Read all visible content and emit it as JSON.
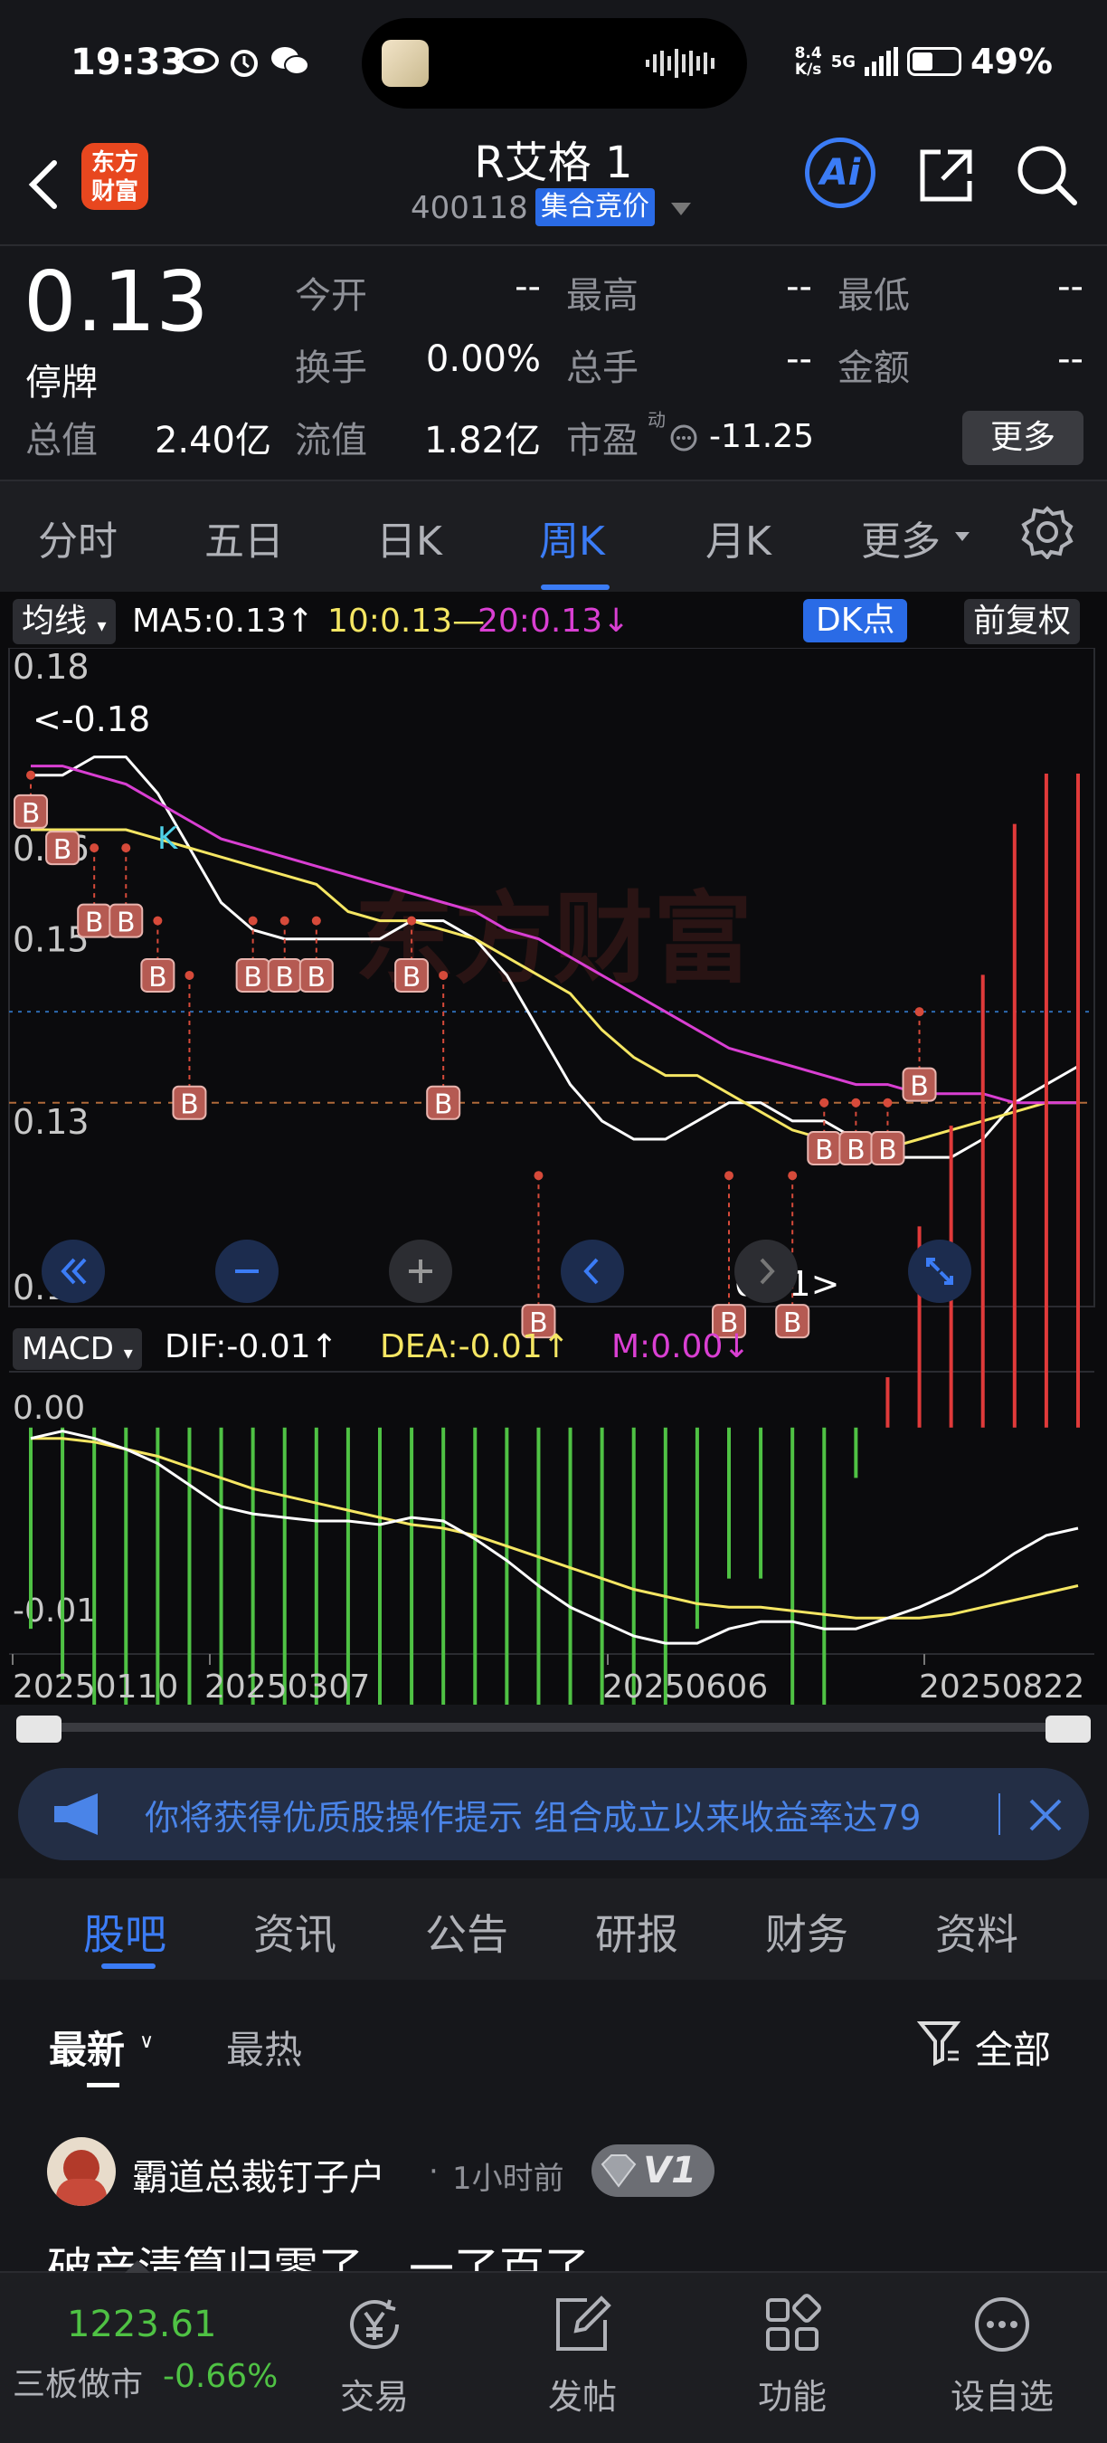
{
  "status_bar": {
    "time": "19:33",
    "net_speed_top": "8.4",
    "net_speed_bottom": "K/s",
    "network": "5G",
    "battery": "49%"
  },
  "header": {
    "logo_line1": "东方",
    "logo_line2": "财富",
    "title": "R艾格 1",
    "code": "400118",
    "auction_badge": "集合竞价",
    "ai_label": "Ai"
  },
  "quote": {
    "price": "0.13",
    "status": "停牌",
    "open_label": "今开",
    "open": "--",
    "high_label": "最高",
    "high": "--",
    "low_label": "最低",
    "low": "--",
    "turnover_label": "换手",
    "turnover": "0.00%",
    "volume_label": "总手",
    "volume": "--",
    "amount_label": "金额",
    "amount": "--",
    "mktcap_label": "总值",
    "mktcap": "2.40亿",
    "float_label": "流值",
    "float": "1.82亿",
    "pe_label": "市盈",
    "pe_sup": "动",
    "pe": "-11.25",
    "more": "更多"
  },
  "tabs": [
    "分时",
    "五日",
    "日K",
    "周K",
    "月K",
    "更多"
  ],
  "active_tab": "周K",
  "chart_toolbar": {
    "ma_selector": "均线",
    "ma5": "MA5:0.13↑",
    "ma10": "10:0.13—",
    "ma20": "20:0.13↓",
    "dk": "DK点",
    "adjust": "前复权"
  },
  "macd_toolbar": {
    "selector": "MACD",
    "dif": "DIF:-0.01↑",
    "dea": "DEA:-0.01↑",
    "m": "M:0.00↓"
  },
  "watermark": "东方财富",
  "chart_data": {
    "type": "line",
    "y_ticks": [
      "0.18",
      "0.16",
      "0.15",
      "0.13",
      "0.11"
    ],
    "annotations": [
      "<-0.18",
      "0.11>",
      "K"
    ],
    "buy_marker": "B",
    "x_ticks": [
      "20250110",
      "20250307",
      "20250606",
      "20250822"
    ],
    "macd_ticks": [
      "0.00",
      "-0.01"
    ],
    "colors": {
      "ma5": "#ffffff",
      "ma10": "#f5e663",
      "ma20": "#d93fd2",
      "macd_up": "#e03a3a",
      "macd_down": "#4fc244",
      "dea": "#f5e663",
      "dif": "#ffffff"
    },
    "series": [
      {
        "name": "MA5",
        "values": [
          0.168,
          0.168,
          0.17,
          0.17,
          0.166,
          0.16,
          0.154,
          0.151,
          0.15,
          0.15,
          0.15,
          0.15,
          0.152,
          0.152,
          0.15,
          0.146,
          0.14,
          0.134,
          0.13,
          0.128,
          0.128,
          0.13,
          0.132,
          0.132,
          0.13,
          0.13,
          0.128,
          0.126,
          0.126,
          0.126,
          0.128,
          0.132,
          0.134,
          0.136
        ]
      },
      {
        "name": "10",
        "values": [
          0.162,
          0.162,
          0.162,
          0.162,
          0.161,
          0.16,
          0.159,
          0.158,
          0.157,
          0.156,
          0.153,
          0.152,
          0.152,
          0.151,
          0.15,
          0.148,
          0.146,
          0.144,
          0.14,
          0.137,
          0.135,
          0.135,
          0.133,
          0.131,
          0.129,
          0.128,
          0.127,
          0.127,
          0.128,
          0.129,
          0.13,
          0.131,
          0.132,
          0.132
        ]
      },
      {
        "name": "20",
        "values": [
          0.169,
          0.169,
          0.168,
          0.167,
          0.165,
          0.163,
          0.161,
          0.16,
          0.159,
          0.158,
          0.157,
          0.156,
          0.155,
          0.154,
          0.153,
          0.151,
          0.15,
          0.148,
          0.146,
          0.144,
          0.142,
          0.14,
          0.138,
          0.137,
          0.136,
          0.135,
          0.134,
          0.134,
          0.133,
          0.133,
          0.133,
          0.132,
          0.132,
          0.132
        ]
      }
    ],
    "macd_bars": [
      -0.0008,
      -0.001,
      -0.0012,
      -0.0015,
      -0.0022,
      -0.003,
      -0.0034,
      -0.0032,
      -0.003,
      -0.0028,
      -0.0026,
      -0.0024,
      -0.002,
      -0.0018,
      -0.0022,
      -0.0028,
      -0.0034,
      -0.0038,
      -0.0036,
      -0.003,
      -0.0024,
      -0.0008,
      -0.0006,
      -0.0006,
      -0.0014,
      -0.0012,
      -0.0002,
      0.0002,
      0.0008,
      0.0012,
      0.0018,
      0.0024,
      0.0026,
      0.0026
    ],
    "dif": [
      -0.0003,
      -0.0001,
      -0.0003,
      -0.0006,
      -0.001,
      -0.0016,
      -0.0022,
      -0.0024,
      -0.0025,
      -0.0026,
      -0.0026,
      -0.0027,
      -0.0025,
      -0.0026,
      -0.0031,
      -0.0037,
      -0.0044,
      -0.005,
      -0.0054,
      -0.0058,
      -0.006,
      -0.006,
      -0.0056,
      -0.0054,
      -0.0054,
      -0.0056,
      -0.0056,
      -0.0053,
      -0.005,
      -0.0046,
      -0.0041,
      -0.0035,
      -0.003,
      -0.0028
    ],
    "dea": [
      -0.0003,
      -0.0003,
      -0.0004,
      -0.0006,
      -0.0008,
      -0.0011,
      -0.0014,
      -0.0017,
      -0.0019,
      -0.0021,
      -0.0023,
      -0.0025,
      -0.0027,
      -0.0028,
      -0.003,
      -0.0033,
      -0.0036,
      -0.0039,
      -0.0042,
      -0.0045,
      -0.0047,
      -0.0049,
      -0.005,
      -0.005,
      -0.0051,
      -0.0052,
      -0.0053,
      -0.0053,
      -0.0053,
      -0.0052,
      -0.005,
      -0.0048,
      -0.0046,
      -0.0044
    ]
  },
  "banner": {
    "text": "你将获得优质股操作提示 组合成立以来收益率达79"
  },
  "section_tabs": [
    "股吧",
    "资讯",
    "公告",
    "研报",
    "财务",
    "资料"
  ],
  "active_section": "股吧",
  "feed": {
    "sort_latest": "最新",
    "sort_hot": "最热",
    "filter": "全部",
    "post": {
      "author": "霸道总裁钉子户",
      "time": "1小时前",
      "level": "V1",
      "title": "破产清算归零了，一了百了"
    }
  },
  "bottom_nav": {
    "index_value": "1223.61",
    "index_name": "三板做市",
    "index_change": "-0.66%",
    "items": [
      "交易",
      "发帖",
      "功能",
      "设自选"
    ]
  }
}
